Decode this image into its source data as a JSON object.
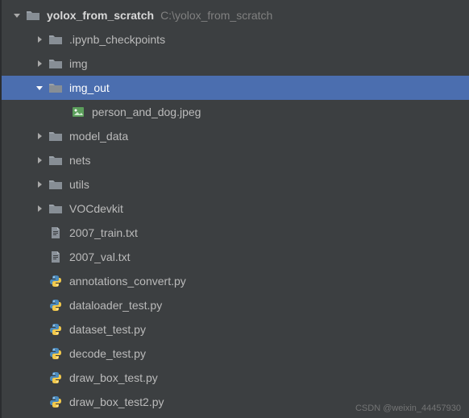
{
  "root": {
    "name": "yolox_from_scratch",
    "path": "C:\\yolox_from_scratch"
  },
  "items": [
    {
      "indent": 0,
      "expand": "open",
      "icon": "folder",
      "name_path": "root.name",
      "extra_path": "root.path",
      "root": true
    },
    {
      "indent": 1,
      "expand": "closed",
      "icon": "folder",
      "label": ".ipynb_checkpoints"
    },
    {
      "indent": 1,
      "expand": "closed",
      "icon": "folder",
      "label": "img"
    },
    {
      "indent": 1,
      "expand": "open",
      "icon": "folder",
      "label": "img_out",
      "selected": true
    },
    {
      "indent": 2,
      "expand": "none",
      "icon": "image",
      "label": "person_and_dog.jpeg"
    },
    {
      "indent": 1,
      "expand": "closed",
      "icon": "folder",
      "label": "model_data"
    },
    {
      "indent": 1,
      "expand": "closed",
      "icon": "folder",
      "label": "nets"
    },
    {
      "indent": 1,
      "expand": "closed",
      "icon": "folder",
      "label": "utils"
    },
    {
      "indent": 1,
      "expand": "closed",
      "icon": "folder",
      "label": "VOCdevkit"
    },
    {
      "indent": 1,
      "expand": "none",
      "icon": "text",
      "label": "2007_train.txt"
    },
    {
      "indent": 1,
      "expand": "none",
      "icon": "text",
      "label": "2007_val.txt"
    },
    {
      "indent": 1,
      "expand": "none",
      "icon": "python",
      "label": "annotations_convert.py"
    },
    {
      "indent": 1,
      "expand": "none",
      "icon": "python",
      "label": "dataloader_test.py"
    },
    {
      "indent": 1,
      "expand": "none",
      "icon": "python",
      "label": "dataset_test.py"
    },
    {
      "indent": 1,
      "expand": "none",
      "icon": "python",
      "label": "decode_test.py"
    },
    {
      "indent": 1,
      "expand": "none",
      "icon": "python",
      "label": "draw_box_test.py"
    },
    {
      "indent": 1,
      "expand": "none",
      "icon": "python",
      "label": "draw_box_test2.py"
    }
  ],
  "watermark": "CSDN @weixin_44457930",
  "icons": {
    "chevron_open_name": "chevron-down-icon",
    "chevron_closed_name": "chevron-right-icon"
  }
}
